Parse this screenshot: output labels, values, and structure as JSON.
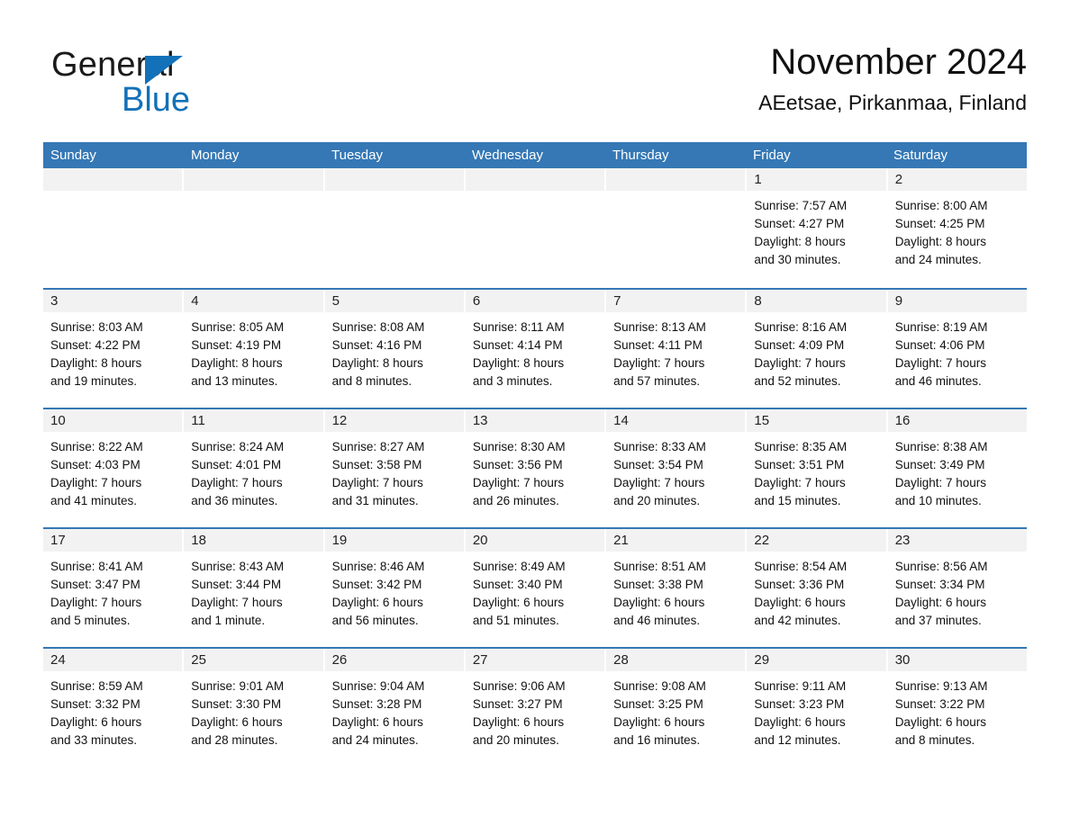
{
  "brand": {
    "name_part1": "General",
    "name_part2": "Blue",
    "accent_color": "#1271b8",
    "logo_icon": "triangle-flag-icon"
  },
  "header": {
    "title": "November 2024",
    "subtitle": "AEetsae, Pirkanmaa, Finland"
  },
  "calendar": {
    "header_bg": "#3578b5",
    "daynum_band_bg": "#f2f2f2",
    "weekdays": [
      "Sunday",
      "Monday",
      "Tuesday",
      "Wednesday",
      "Thursday",
      "Friday",
      "Saturday"
    ],
    "weeks": [
      [
        {
          "day": "",
          "sunrise": "",
          "sunset": "",
          "daylight_line1": "",
          "daylight_line2": ""
        },
        {
          "day": "",
          "sunrise": "",
          "sunset": "",
          "daylight_line1": "",
          "daylight_line2": ""
        },
        {
          "day": "",
          "sunrise": "",
          "sunset": "",
          "daylight_line1": "",
          "daylight_line2": ""
        },
        {
          "day": "",
          "sunrise": "",
          "sunset": "",
          "daylight_line1": "",
          "daylight_line2": ""
        },
        {
          "day": "",
          "sunrise": "",
          "sunset": "",
          "daylight_line1": "",
          "daylight_line2": ""
        },
        {
          "day": "1",
          "sunrise": "Sunrise: 7:57 AM",
          "sunset": "Sunset: 4:27 PM",
          "daylight_line1": "Daylight: 8 hours",
          "daylight_line2": "and 30 minutes."
        },
        {
          "day": "2",
          "sunrise": "Sunrise: 8:00 AM",
          "sunset": "Sunset: 4:25 PM",
          "daylight_line1": "Daylight: 8 hours",
          "daylight_line2": "and 24 minutes."
        }
      ],
      [
        {
          "day": "3",
          "sunrise": "Sunrise: 8:03 AM",
          "sunset": "Sunset: 4:22 PM",
          "daylight_line1": "Daylight: 8 hours",
          "daylight_line2": "and 19 minutes."
        },
        {
          "day": "4",
          "sunrise": "Sunrise: 8:05 AM",
          "sunset": "Sunset: 4:19 PM",
          "daylight_line1": "Daylight: 8 hours",
          "daylight_line2": "and 13 minutes."
        },
        {
          "day": "5",
          "sunrise": "Sunrise: 8:08 AM",
          "sunset": "Sunset: 4:16 PM",
          "daylight_line1": "Daylight: 8 hours",
          "daylight_line2": "and 8 minutes."
        },
        {
          "day": "6",
          "sunrise": "Sunrise: 8:11 AM",
          "sunset": "Sunset: 4:14 PM",
          "daylight_line1": "Daylight: 8 hours",
          "daylight_line2": "and 3 minutes."
        },
        {
          "day": "7",
          "sunrise": "Sunrise: 8:13 AM",
          "sunset": "Sunset: 4:11 PM",
          "daylight_line1": "Daylight: 7 hours",
          "daylight_line2": "and 57 minutes."
        },
        {
          "day": "8",
          "sunrise": "Sunrise: 8:16 AM",
          "sunset": "Sunset: 4:09 PM",
          "daylight_line1": "Daylight: 7 hours",
          "daylight_line2": "and 52 minutes."
        },
        {
          "day": "9",
          "sunrise": "Sunrise: 8:19 AM",
          "sunset": "Sunset: 4:06 PM",
          "daylight_line1": "Daylight: 7 hours",
          "daylight_line2": "and 46 minutes."
        }
      ],
      [
        {
          "day": "10",
          "sunrise": "Sunrise: 8:22 AM",
          "sunset": "Sunset: 4:03 PM",
          "daylight_line1": "Daylight: 7 hours",
          "daylight_line2": "and 41 minutes."
        },
        {
          "day": "11",
          "sunrise": "Sunrise: 8:24 AM",
          "sunset": "Sunset: 4:01 PM",
          "daylight_line1": "Daylight: 7 hours",
          "daylight_line2": "and 36 minutes."
        },
        {
          "day": "12",
          "sunrise": "Sunrise: 8:27 AM",
          "sunset": "Sunset: 3:58 PM",
          "daylight_line1": "Daylight: 7 hours",
          "daylight_line2": "and 31 minutes."
        },
        {
          "day": "13",
          "sunrise": "Sunrise: 8:30 AM",
          "sunset": "Sunset: 3:56 PM",
          "daylight_line1": "Daylight: 7 hours",
          "daylight_line2": "and 26 minutes."
        },
        {
          "day": "14",
          "sunrise": "Sunrise: 8:33 AM",
          "sunset": "Sunset: 3:54 PM",
          "daylight_line1": "Daylight: 7 hours",
          "daylight_line2": "and 20 minutes."
        },
        {
          "day": "15",
          "sunrise": "Sunrise: 8:35 AM",
          "sunset": "Sunset: 3:51 PM",
          "daylight_line1": "Daylight: 7 hours",
          "daylight_line2": "and 15 minutes."
        },
        {
          "day": "16",
          "sunrise": "Sunrise: 8:38 AM",
          "sunset": "Sunset: 3:49 PM",
          "daylight_line1": "Daylight: 7 hours",
          "daylight_line2": "and 10 minutes."
        }
      ],
      [
        {
          "day": "17",
          "sunrise": "Sunrise: 8:41 AM",
          "sunset": "Sunset: 3:47 PM",
          "daylight_line1": "Daylight: 7 hours",
          "daylight_line2": "and 5 minutes."
        },
        {
          "day": "18",
          "sunrise": "Sunrise: 8:43 AM",
          "sunset": "Sunset: 3:44 PM",
          "daylight_line1": "Daylight: 7 hours",
          "daylight_line2": "and 1 minute."
        },
        {
          "day": "19",
          "sunrise": "Sunrise: 8:46 AM",
          "sunset": "Sunset: 3:42 PM",
          "daylight_line1": "Daylight: 6 hours",
          "daylight_line2": "and 56 minutes."
        },
        {
          "day": "20",
          "sunrise": "Sunrise: 8:49 AM",
          "sunset": "Sunset: 3:40 PM",
          "daylight_line1": "Daylight: 6 hours",
          "daylight_line2": "and 51 minutes."
        },
        {
          "day": "21",
          "sunrise": "Sunrise: 8:51 AM",
          "sunset": "Sunset: 3:38 PM",
          "daylight_line1": "Daylight: 6 hours",
          "daylight_line2": "and 46 minutes."
        },
        {
          "day": "22",
          "sunrise": "Sunrise: 8:54 AM",
          "sunset": "Sunset: 3:36 PM",
          "daylight_line1": "Daylight: 6 hours",
          "daylight_line2": "and 42 minutes."
        },
        {
          "day": "23",
          "sunrise": "Sunrise: 8:56 AM",
          "sunset": "Sunset: 3:34 PM",
          "daylight_line1": "Daylight: 6 hours",
          "daylight_line2": "and 37 minutes."
        }
      ],
      [
        {
          "day": "24",
          "sunrise": "Sunrise: 8:59 AM",
          "sunset": "Sunset: 3:32 PM",
          "daylight_line1": "Daylight: 6 hours",
          "daylight_line2": "and 33 minutes."
        },
        {
          "day": "25",
          "sunrise": "Sunrise: 9:01 AM",
          "sunset": "Sunset: 3:30 PM",
          "daylight_line1": "Daylight: 6 hours",
          "daylight_line2": "and 28 minutes."
        },
        {
          "day": "26",
          "sunrise": "Sunrise: 9:04 AM",
          "sunset": "Sunset: 3:28 PM",
          "daylight_line1": "Daylight: 6 hours",
          "daylight_line2": "and 24 minutes."
        },
        {
          "day": "27",
          "sunrise": "Sunrise: 9:06 AM",
          "sunset": "Sunset: 3:27 PM",
          "daylight_line1": "Daylight: 6 hours",
          "daylight_line2": "and 20 minutes."
        },
        {
          "day": "28",
          "sunrise": "Sunrise: 9:08 AM",
          "sunset": "Sunset: 3:25 PM",
          "daylight_line1": "Daylight: 6 hours",
          "daylight_line2": "and 16 minutes."
        },
        {
          "day": "29",
          "sunrise": "Sunrise: 9:11 AM",
          "sunset": "Sunset: 3:23 PM",
          "daylight_line1": "Daylight: 6 hours",
          "daylight_line2": "and 12 minutes."
        },
        {
          "day": "30",
          "sunrise": "Sunrise: 9:13 AM",
          "sunset": "Sunset: 3:22 PM",
          "daylight_line1": "Daylight: 6 hours",
          "daylight_line2": "and 8 minutes."
        }
      ]
    ]
  }
}
